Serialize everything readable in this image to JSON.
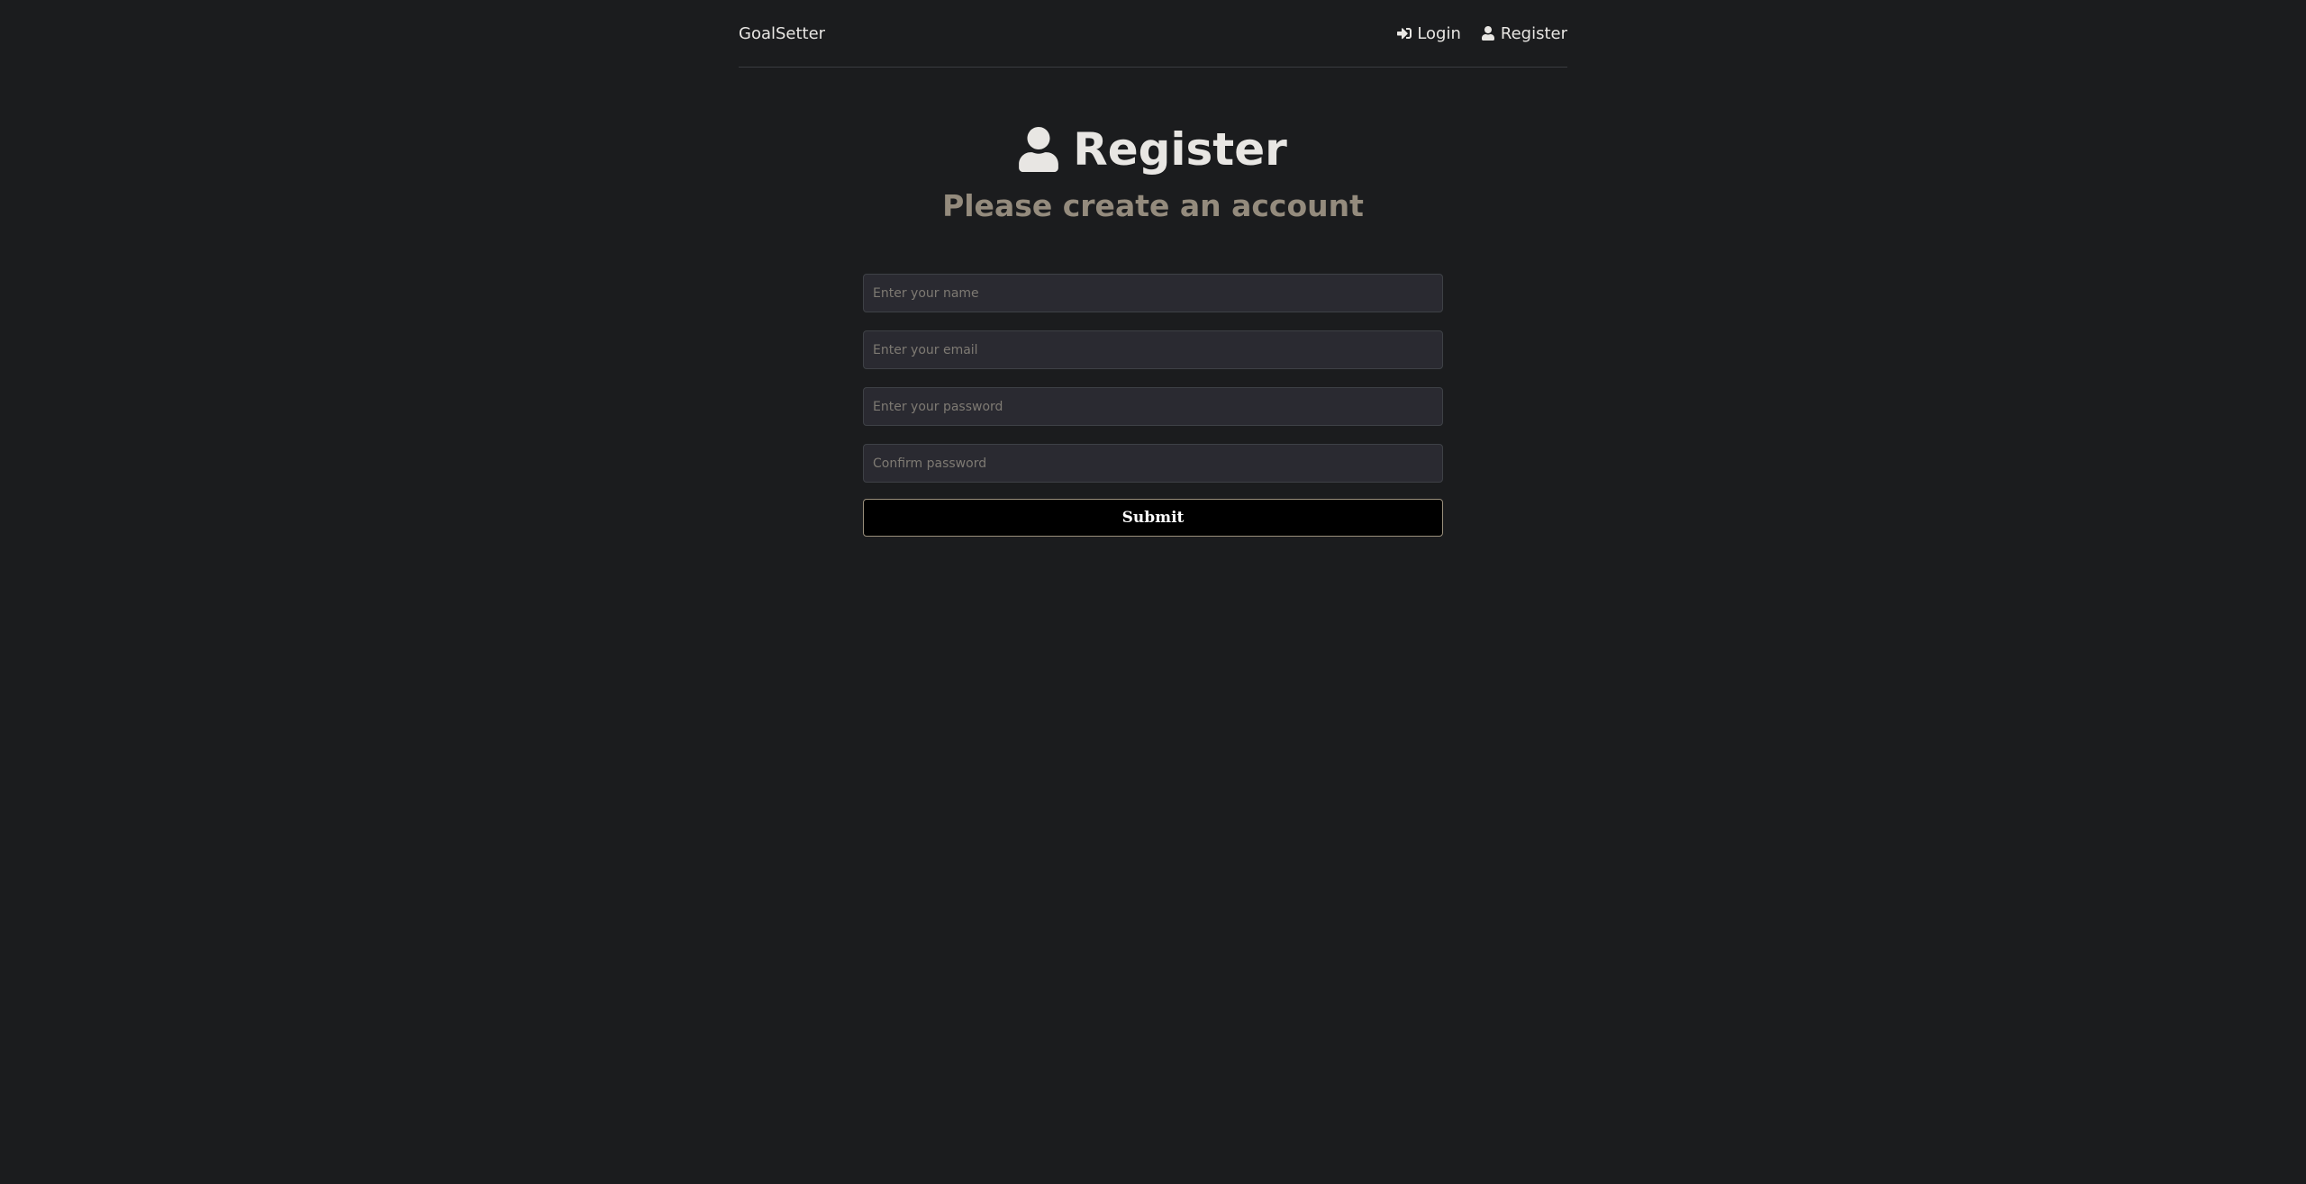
{
  "header": {
    "logo": "GoalSetter",
    "nav": {
      "login_label": "Login",
      "register_label": "Register",
      "login_icon": "sign-in-icon",
      "register_icon": "user-icon"
    }
  },
  "heading": {
    "icon": "user-icon",
    "title": "Register",
    "subtitle": "Please create an account"
  },
  "form": {
    "name_placeholder": "Enter your name",
    "email_placeholder": "Enter your email",
    "password_placeholder": "Enter your password",
    "confirm_placeholder": "Confirm password",
    "submit_label": "Submit"
  },
  "colors": {
    "background": "#1b1c1e",
    "subtitle": "#948b7d",
    "input_background": "#2a2a31",
    "button_background": "#000000"
  }
}
